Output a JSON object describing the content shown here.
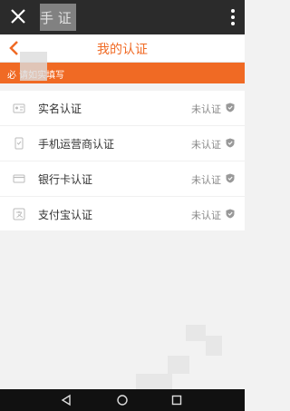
{
  "topbar": {
    "title_partial": "手          证",
    "close_icon": "close-icon",
    "more_icon": "more-vertical-icon"
  },
  "navbar": {
    "title": "我的认证",
    "back_icon": "back-chevron-icon"
  },
  "banner": {
    "text": "必         请如实填写"
  },
  "cert_items": [
    {
      "label": "实名认证",
      "status": "未认证",
      "icon": "id-card-icon"
    },
    {
      "label": "手机运营商认证",
      "status": "未认证",
      "icon": "phone-icon"
    },
    {
      "label": "银行卡认证",
      "status": "未认证",
      "icon": "bank-card-icon"
    },
    {
      "label": "支付宝认证",
      "status": "未认证",
      "icon": "alipay-icon"
    }
  ],
  "system_nav": {
    "back": "system-back-icon",
    "home": "system-home-icon",
    "recents": "system-recents-icon"
  },
  "colors": {
    "accent": "#f06a24",
    "topbar": "#2b2b2b",
    "background": "#f2f2f2"
  }
}
